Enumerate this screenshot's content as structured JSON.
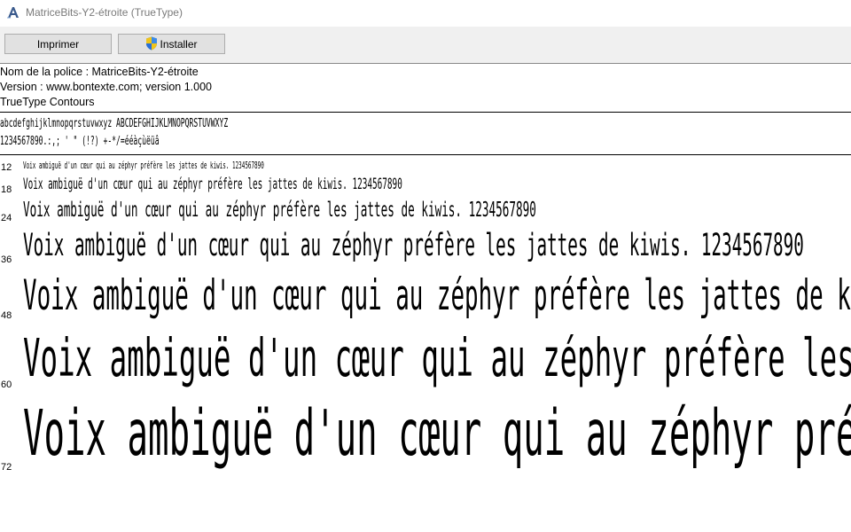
{
  "window": {
    "title": "MatriceBits-Y2-étroite (TrueType)",
    "icon": "font-viewer-icon"
  },
  "toolbar": {
    "print_label": "Imprimer",
    "install_label": "Installer",
    "install_icon": "uac-shield-icon"
  },
  "info": {
    "font_name": "Nom de la police : MatriceBits-Y2-étroite",
    "version": "Version : www.bontexte.com; version 1.000",
    "type": "TrueType  Contours"
  },
  "charset": {
    "line1": "abcdefghijklmnopqrstuvwxyz ABCDEFGHIJKLMNOPQRSTUVWXYZ",
    "line2": "1234567890.:,; ' \" (!?) +-*/=ééàçùëüâ"
  },
  "samples": {
    "text": "Voix ambiguë d'un cœur qui au zéphyr préfère les jattes de kiwis. 1234567890",
    "sizes": [
      "12",
      "18",
      "24",
      "36",
      "48",
      "60",
      "72"
    ]
  }
}
